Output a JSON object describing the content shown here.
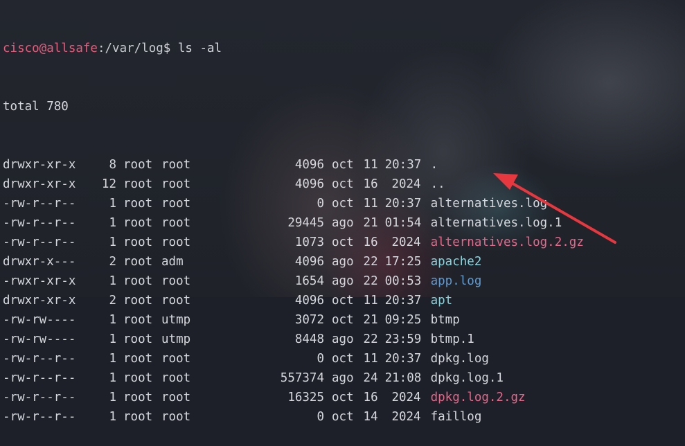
{
  "prompt": {
    "user_host": "cisco@allsafe",
    "path": ":/var/log",
    "symbol": "$ ",
    "command": "ls -al"
  },
  "total_line": "total 780",
  "entries": [
    {
      "perm": "drwxr-xr-x",
      "links": "8",
      "owner": "root",
      "group": "root",
      "size": "4096",
      "month": "oct",
      "day": "11",
      "time": "20:37",
      "name": ".",
      "kind": "dir"
    },
    {
      "perm": "drwxr-xr-x",
      "links": "12",
      "owner": "root",
      "group": "root",
      "size": "4096",
      "month": "oct",
      "day": "16",
      "time": "2024",
      "name": "..",
      "kind": "dir"
    },
    {
      "perm": "-rw-r--r--",
      "links": "1",
      "owner": "root",
      "group": "root",
      "size": "0",
      "month": "oct",
      "day": "11",
      "time": "20:37",
      "name": "alternatives.log",
      "kind": "file"
    },
    {
      "perm": "-rw-r--r--",
      "links": "1",
      "owner": "root",
      "group": "root",
      "size": "29445",
      "month": "ago",
      "day": "21",
      "time": "01:54",
      "name": "alternatives.log.1",
      "kind": "file"
    },
    {
      "perm": "-rw-r--r--",
      "links": "1",
      "owner": "root",
      "group": "root",
      "size": "1073",
      "month": "oct",
      "day": "16",
      "time": "2024",
      "name": "alternatives.log.2.gz",
      "kind": "gz"
    },
    {
      "perm": "drwxr-x---",
      "links": "2",
      "owner": "root",
      "group": "adm",
      "size": "4096",
      "month": "ago",
      "day": "22",
      "time": "17:25",
      "name": "apache2",
      "kind": "cyan"
    },
    {
      "perm": "-rwxr-xr-x",
      "links": "1",
      "owner": "root",
      "group": "root",
      "size": "1654",
      "month": "ago",
      "day": "22",
      "time": "00:53",
      "name": "app.log",
      "kind": "exec"
    },
    {
      "perm": "drwxr-xr-x",
      "links": "2",
      "owner": "root",
      "group": "root",
      "size": "4096",
      "month": "oct",
      "day": "11",
      "time": "20:37",
      "name": "apt",
      "kind": "cyan"
    },
    {
      "perm": "-rw-rw----",
      "links": "1",
      "owner": "root",
      "group": "utmp",
      "size": "3072",
      "month": "oct",
      "day": "21",
      "time": "09:25",
      "name": "btmp",
      "kind": "file"
    },
    {
      "perm": "-rw-rw----",
      "links": "1",
      "owner": "root",
      "group": "utmp",
      "size": "8448",
      "month": "ago",
      "day": "22",
      "time": "23:59",
      "name": "btmp.1",
      "kind": "file"
    },
    {
      "perm": "-rw-r--r--",
      "links": "1",
      "owner": "root",
      "group": "root",
      "size": "0",
      "month": "oct",
      "day": "11",
      "time": "20:37",
      "name": "dpkg.log",
      "kind": "file"
    },
    {
      "perm": "-rw-r--r--",
      "links": "1",
      "owner": "root",
      "group": "root",
      "size": "557374",
      "month": "ago",
      "day": "24",
      "time": "21:08",
      "name": "dpkg.log.1",
      "kind": "file"
    },
    {
      "perm": "-rw-r--r--",
      "links": "1",
      "owner": "root",
      "group": "root",
      "size": "16325",
      "month": "oct",
      "day": "16",
      "time": "2024",
      "name": "dpkg.log.2.gz",
      "kind": "gz"
    },
    {
      "perm": "-rw-r--r--",
      "links": "1",
      "owner": "root",
      "group": "root",
      "size": "0",
      "month": "oct",
      "day": "14",
      "time": "2024",
      "name": "faillog",
      "kind": "file"
    }
  ],
  "annotation": {
    "icon": "red-arrow-icon",
    "color": "#e8383f",
    "points_to": "app.log"
  },
  "colors": {
    "background": "#1d2028",
    "prompt_user": "#e65c7b",
    "gz": "#e6678a",
    "directory": "#8ad3dc",
    "executable": "#5f9bd1"
  }
}
